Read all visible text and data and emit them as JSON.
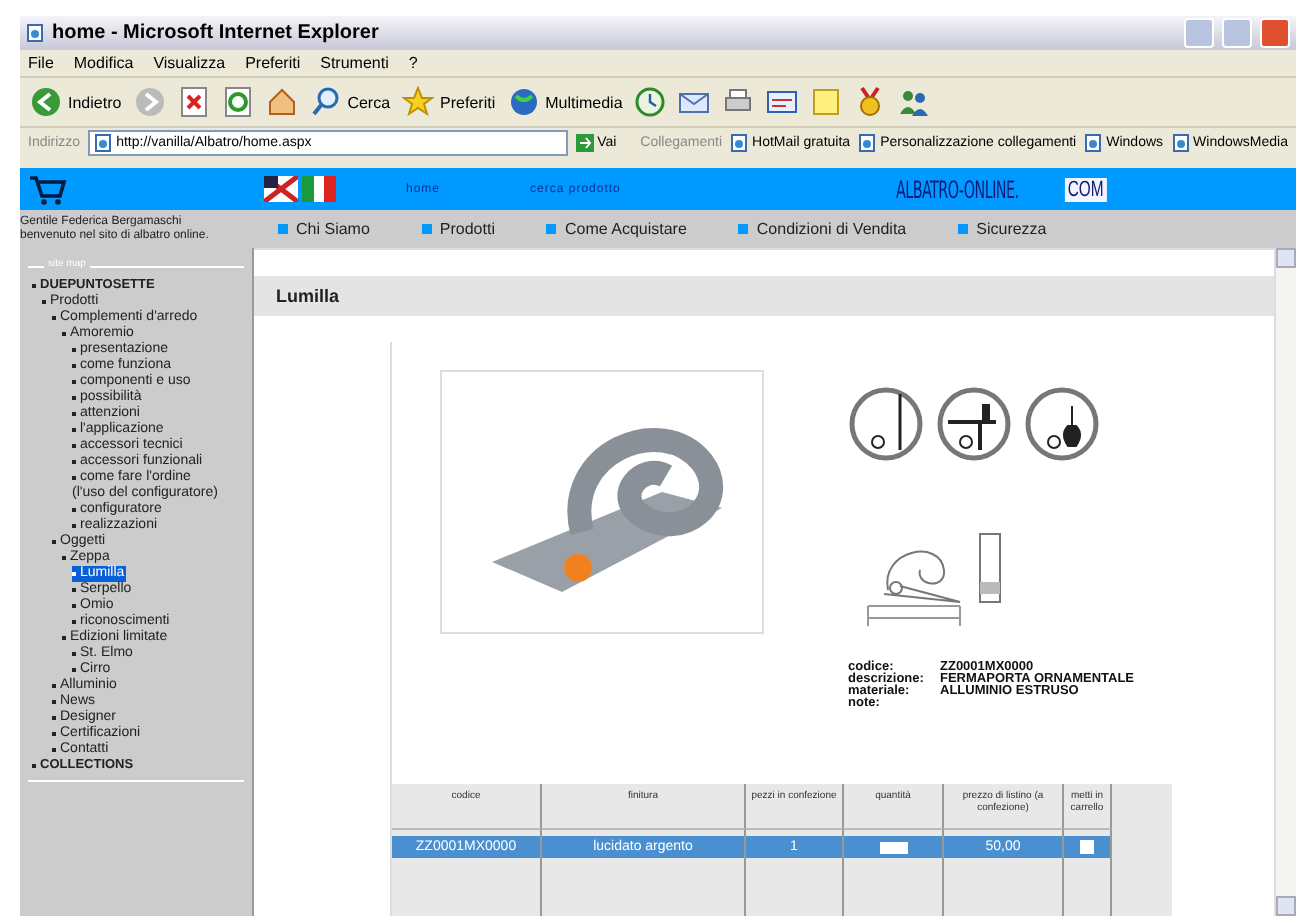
{
  "window": {
    "title": "home - Microsoft Internet Explorer"
  },
  "menu": [
    "File",
    "Modifica",
    "Visualizza",
    "Preferiti",
    "Strumenti",
    "?"
  ],
  "toolbar": [
    {
      "kind": "back",
      "label": "Indietro"
    },
    {
      "kind": "forward"
    },
    {
      "kind": "stop"
    },
    {
      "kind": "refresh"
    },
    {
      "kind": "home"
    },
    {
      "kind": "search",
      "label": "Cerca"
    },
    {
      "kind": "favorites",
      "label": "Preferiti"
    },
    {
      "kind": "media",
      "label": "Multimedia"
    },
    {
      "kind": "history"
    },
    {
      "kind": "mail"
    },
    {
      "kind": "print"
    },
    {
      "kind": "edit"
    },
    {
      "kind": "note"
    },
    {
      "kind": "medal"
    },
    {
      "kind": "people"
    }
  ],
  "address": {
    "label": "Indirizzo",
    "value": "http://vanilla/Albatro/home.aspx",
    "go": "Vai",
    "links_label": "Collegamenti",
    "links": [
      "HotMail gratuita",
      "Personalizzazione collegamenti",
      "Windows",
      "WindowsMedia"
    ]
  },
  "header": {
    "links": [
      "home",
      "cerca prodotto"
    ],
    "logo": "ALBATRO-ONLINE.",
    "logo_suffix": "COM"
  },
  "greeting": [
    "Gentile Federica Bergamaschi",
    "benvenuto nel sito di albatro online."
  ],
  "nav": [
    "Chi Siamo",
    "Prodotti",
    "Come Acquistare",
    "Condizioni di Vendita",
    "Sicurezza"
  ],
  "sitemap": {
    "legend": "site map",
    "tree": [
      {
        "label": "DUEPUNTOSETTE",
        "kind": "section",
        "selected": false,
        "children": [
          {
            "label": "Prodotti",
            "kind": "link",
            "selected": false,
            "children": [
              {
                "label": "Complementi d'arredo",
                "kind": "link",
                "selected": false,
                "children": [
                  {
                    "label": "Amoremio",
                    "kind": "link",
                    "selected": false,
                    "children": [
                      {
                        "label": "presentazione",
                        "kind": "link",
                        "selected": false
                      },
                      {
                        "label": "come funziona",
                        "kind": "link",
                        "selected": false
                      },
                      {
                        "label": "componenti e uso",
                        "kind": "link",
                        "selected": false
                      },
                      {
                        "label": "possibilità",
                        "kind": "link",
                        "selected": false
                      },
                      {
                        "label": "attenzioni",
                        "kind": "link",
                        "selected": false
                      },
                      {
                        "label": "l'applicazione",
                        "kind": "link",
                        "selected": false
                      },
                      {
                        "label": "accessori tecnici",
                        "kind": "link",
                        "selected": false
                      },
                      {
                        "label": "accessori funzionali",
                        "kind": "link",
                        "selected": false
                      },
                      {
                        "label": "come fare l'ordine",
                        "kind": "link",
                        "selected": false
                      },
                      {
                        "label": "(l'uso del configuratore)",
                        "kind": "note",
                        "selected": false
                      },
                      {
                        "label": "configuratore",
                        "kind": "link",
                        "selected": false
                      },
                      {
                        "label": "realizzazioni",
                        "kind": "link",
                        "selected": false
                      }
                    ]
                  }
                ]
              },
              {
                "label": "Oggetti",
                "kind": "link",
                "selected": false,
                "children": [
                  {
                    "label": "Zeppa",
                    "kind": "link",
                    "selected": false,
                    "children": [
                      {
                        "label": "Lumilla",
                        "kind": "link",
                        "selected": true
                      },
                      {
                        "label": "Serpello",
                        "kind": "link",
                        "selected": false
                      },
                      {
                        "label": "Omio",
                        "kind": "link",
                        "selected": false
                      },
                      {
                        "label": "riconoscimenti",
                        "kind": "link",
                        "selected": false
                      }
                    ]
                  },
                  {
                    "label": "Edizioni limitate",
                    "kind": "link",
                    "selected": false,
                    "children": [
                      {
                        "label": "St. Elmo",
                        "kind": "link",
                        "selected": false
                      },
                      {
                        "label": "Cirro",
                        "kind": "link",
                        "selected": false
                      }
                    ]
                  }
                ]
              },
              {
                "label": "Alluminio",
                "kind": "link",
                "selected": false
              },
              {
                "label": "News",
                "kind": "link",
                "selected": false
              },
              {
                "label": "Designer",
                "kind": "link",
                "selected": false
              },
              {
                "label": "Certificazioni",
                "kind": "link",
                "selected": false
              },
              {
                "label": "Contatti",
                "kind": "link",
                "selected": false
              }
            ]
          }
        ]
      },
      {
        "label": "COLLECTIONS",
        "kind": "section",
        "selected": false
      }
    ]
  },
  "page_title": "Lumilla",
  "details": [
    {
      "label": "codice:",
      "value": "ZZ0001MX0000"
    },
    {
      "label": "descrizione:",
      "value": "FERMAPORTA ORNAMENTALE"
    },
    {
      "label": "materiale:",
      "value": "ALLUMINIO ESTRUSO"
    },
    {
      "label": "note:"
    }
  ],
  "table": {
    "columns": [
      "codice",
      "finitura",
      "pezzi in confezione",
      "quantità",
      "prezzo di listino (a confezione)",
      "metti in carrello"
    ],
    "rows": [
      {
        "selected": true,
        "code": "ZZ0001MX0000",
        "finish": "lucidato argento",
        "pieces": "1",
        "price": "50,00",
        "in_cart": false
      }
    ]
  }
}
